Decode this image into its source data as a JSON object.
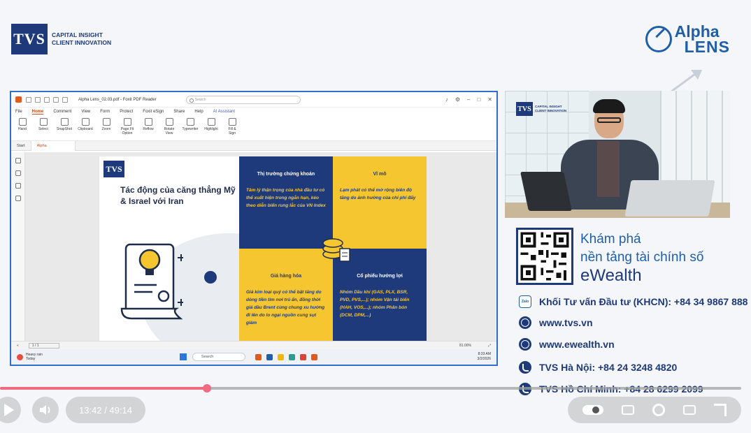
{
  "header": {
    "tvs_logo": "TVS",
    "tvs_tagline_1": "CAPITAL INSIGHT",
    "tvs_tagline_2": "CLIENT INNOVATION",
    "alpha_logo_1": "Alpha",
    "alpha_logo_2": "LENS"
  },
  "pdf_app": {
    "title": "Alpha Lens_02.03.pdf - Foxit PDF Reader",
    "search_placeholder": "Search",
    "menu": [
      "File",
      "Home",
      "Comment",
      "View",
      "Form",
      "Protect",
      "Foxit eSign",
      "Share",
      "Help",
      "AI Assistant"
    ],
    "ribbon": [
      "Hand",
      "Select",
      "SnapShot",
      "Clipboard",
      "Zoom",
      "Page Fit Option",
      "Reflow",
      "Rotate View",
      "Typewriter",
      "Highlight",
      "Fill & Sign"
    ],
    "tabs": {
      "start": "Start",
      "doc": "Alpha Lens_02.03"
    },
    "page_indicator": "1 / 1",
    "zoom": "81.00%"
  },
  "slide": {
    "logo": "TVS",
    "title": "Tác động của căng thẳng Mỹ & Israel với Iran",
    "quadrants": [
      {
        "heading": "Thị trường chứng khoán",
        "body": "Tâm lý thận trọng của nhà đầu tư có thể xuất hiện trong ngắn hạn, kéo theo diễn biến rung lắc của VN Index"
      },
      {
        "heading": "Vĩ mô",
        "body": "Lạm phát có thể mở rộng biên độ tăng do ảnh hưởng của chi phí đẩy"
      },
      {
        "heading": "Giá hàng hóa",
        "body": "Giá kim loại quý có thể bật tăng do dòng tiền tìm nơi trú ẩn, đồng thời giá dầu Brent cùng chung xu hướng đi lên do lo ngại nguồn cung sụt giảm"
      },
      {
        "heading": "Cổ phiếu hưởng lợi",
        "body": "Nhóm Dầu khí (GAS, PLX, BSR, PVD, PVS,...); nhóm Vận tải biển (HAH, VOS,...); nhóm Phân bón (DCM, DPM,...)"
      }
    ]
  },
  "taskbar": {
    "weather_1": "Heavy rain",
    "weather_2": "Today",
    "search": "Search",
    "time": "8:33 AM",
    "date": "3/2/2026"
  },
  "camera": {
    "tvs_logo": "TVS",
    "tagline_1": "CAPITAL INSIGHT",
    "tagline_2": "CLIENT INNOVATION"
  },
  "promo": {
    "line1": "Khám phá",
    "line2": "nền tảng tài chính số",
    "line3": "eWealth"
  },
  "contacts": {
    "zalo_label": "Zalo",
    "khcn": "Khối Tư vấn Đầu tư (KHCN): +84 34 9867 888",
    "site1": "www.tvs.vn",
    "site2": "www.ewealth.vn",
    "hanoi": "TVS Hà Nội: +84 24 3248 4820",
    "hcm": "TVS Hồ Chí Minh: +84 28 6299 2099"
  },
  "player": {
    "time": "13:42 / 49:14",
    "progress": 0.279
  },
  "colors": {
    "brand_navy": "#1f3a7a",
    "brand_yellow": "#f6c631",
    "progress_red": "#f06b82"
  }
}
